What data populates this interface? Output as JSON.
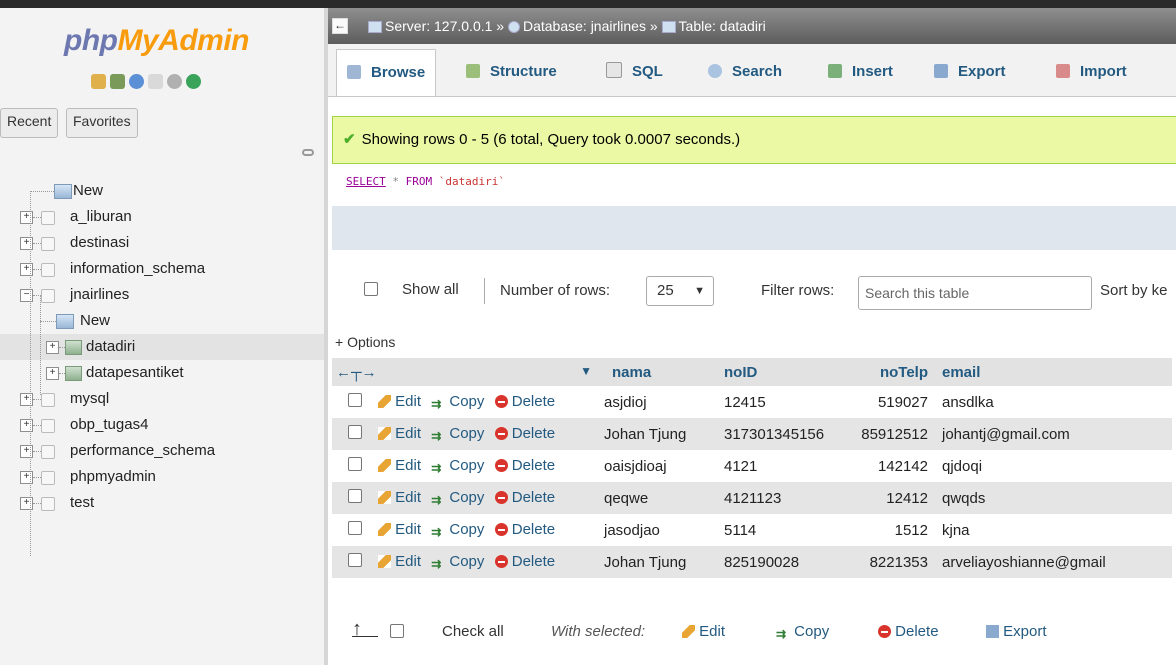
{
  "sidebar": {
    "logo_php": "php",
    "logo_my": "MyAdmin",
    "recent_label": "Recent",
    "favorites_label": "Favorites",
    "tree": [
      {
        "label": "New",
        "kind": "new"
      },
      {
        "label": "a_liburan",
        "kind": "db"
      },
      {
        "label": "destinasi",
        "kind": "db"
      },
      {
        "label": "information_schema",
        "kind": "db"
      },
      {
        "label": "jnairlines",
        "kind": "db-open"
      },
      {
        "label": "New",
        "kind": "new-child"
      },
      {
        "label": "datadiri",
        "kind": "table",
        "selected": true
      },
      {
        "label": "datapesantiket",
        "kind": "table"
      },
      {
        "label": "mysql",
        "kind": "db"
      },
      {
        "label": "obp_tugas4",
        "kind": "db"
      },
      {
        "label": "performance_schema",
        "kind": "db"
      },
      {
        "label": "phpmyadmin",
        "kind": "db"
      },
      {
        "label": "test",
        "kind": "db"
      }
    ]
  },
  "breadcrumb": {
    "server": "Server: 127.0.0.1",
    "database": "Database: jnairlines",
    "table": "Table: datadiri",
    "sep": "»"
  },
  "tabs": [
    "Browse",
    "Structure",
    "SQL",
    "Search",
    "Insert",
    "Export",
    "Import"
  ],
  "active_tab": "Browse",
  "message": "Showing rows 0 - 5 (6 total, Query took 0.0007 seconds.)",
  "query": {
    "select": "SELECT",
    "star": "*",
    "from": "FROM",
    "table": "`datadiri`"
  },
  "controls": {
    "show_all": "Show all",
    "rows_label": "Number of rows:",
    "rows_value": "25",
    "filter_label": "Filter rows:",
    "filter_placeholder": "Search this table",
    "sort_label": "Sort by ke"
  },
  "options_label": "+ Options",
  "table": {
    "columns": [
      "nama",
      "noID",
      "noTelp",
      "email"
    ],
    "action_labels": {
      "edit": "Edit",
      "copy": "Copy",
      "delete": "Delete"
    },
    "rows": [
      {
        "nama": "asjdioj",
        "noID": "12415",
        "noTelp": "519027",
        "email": "ansdlka"
      },
      {
        "nama": "Johan Tjung",
        "noID": "317301345156",
        "noTelp": "85912512",
        "email": "johantj@gmail.com"
      },
      {
        "nama": "oaisjdioaj",
        "noID": "4121",
        "noTelp": "142142",
        "email": "qjdoqi"
      },
      {
        "nama": "qeqwe",
        "noID": "4121123",
        "noTelp": "12412",
        "email": "qwqds"
      },
      {
        "nama": "jasodjao",
        "noID": "5114",
        "noTelp": "1512",
        "email": "kjna"
      },
      {
        "nama": "Johan Tjung",
        "noID": "825190028",
        "noTelp": "8221353",
        "email": "arveliayoshianne@gmail"
      }
    ]
  },
  "footer": {
    "check_all": "Check all",
    "with_selected": "With selected:",
    "edit": "Edit",
    "copy": "Copy",
    "delete": "Delete",
    "export": "Export"
  },
  "colors": {
    "link": "#235a81",
    "success_bg": "#ebf8a4",
    "logo_php": "#6c78af",
    "logo_myadmin": "#f89c0e"
  }
}
